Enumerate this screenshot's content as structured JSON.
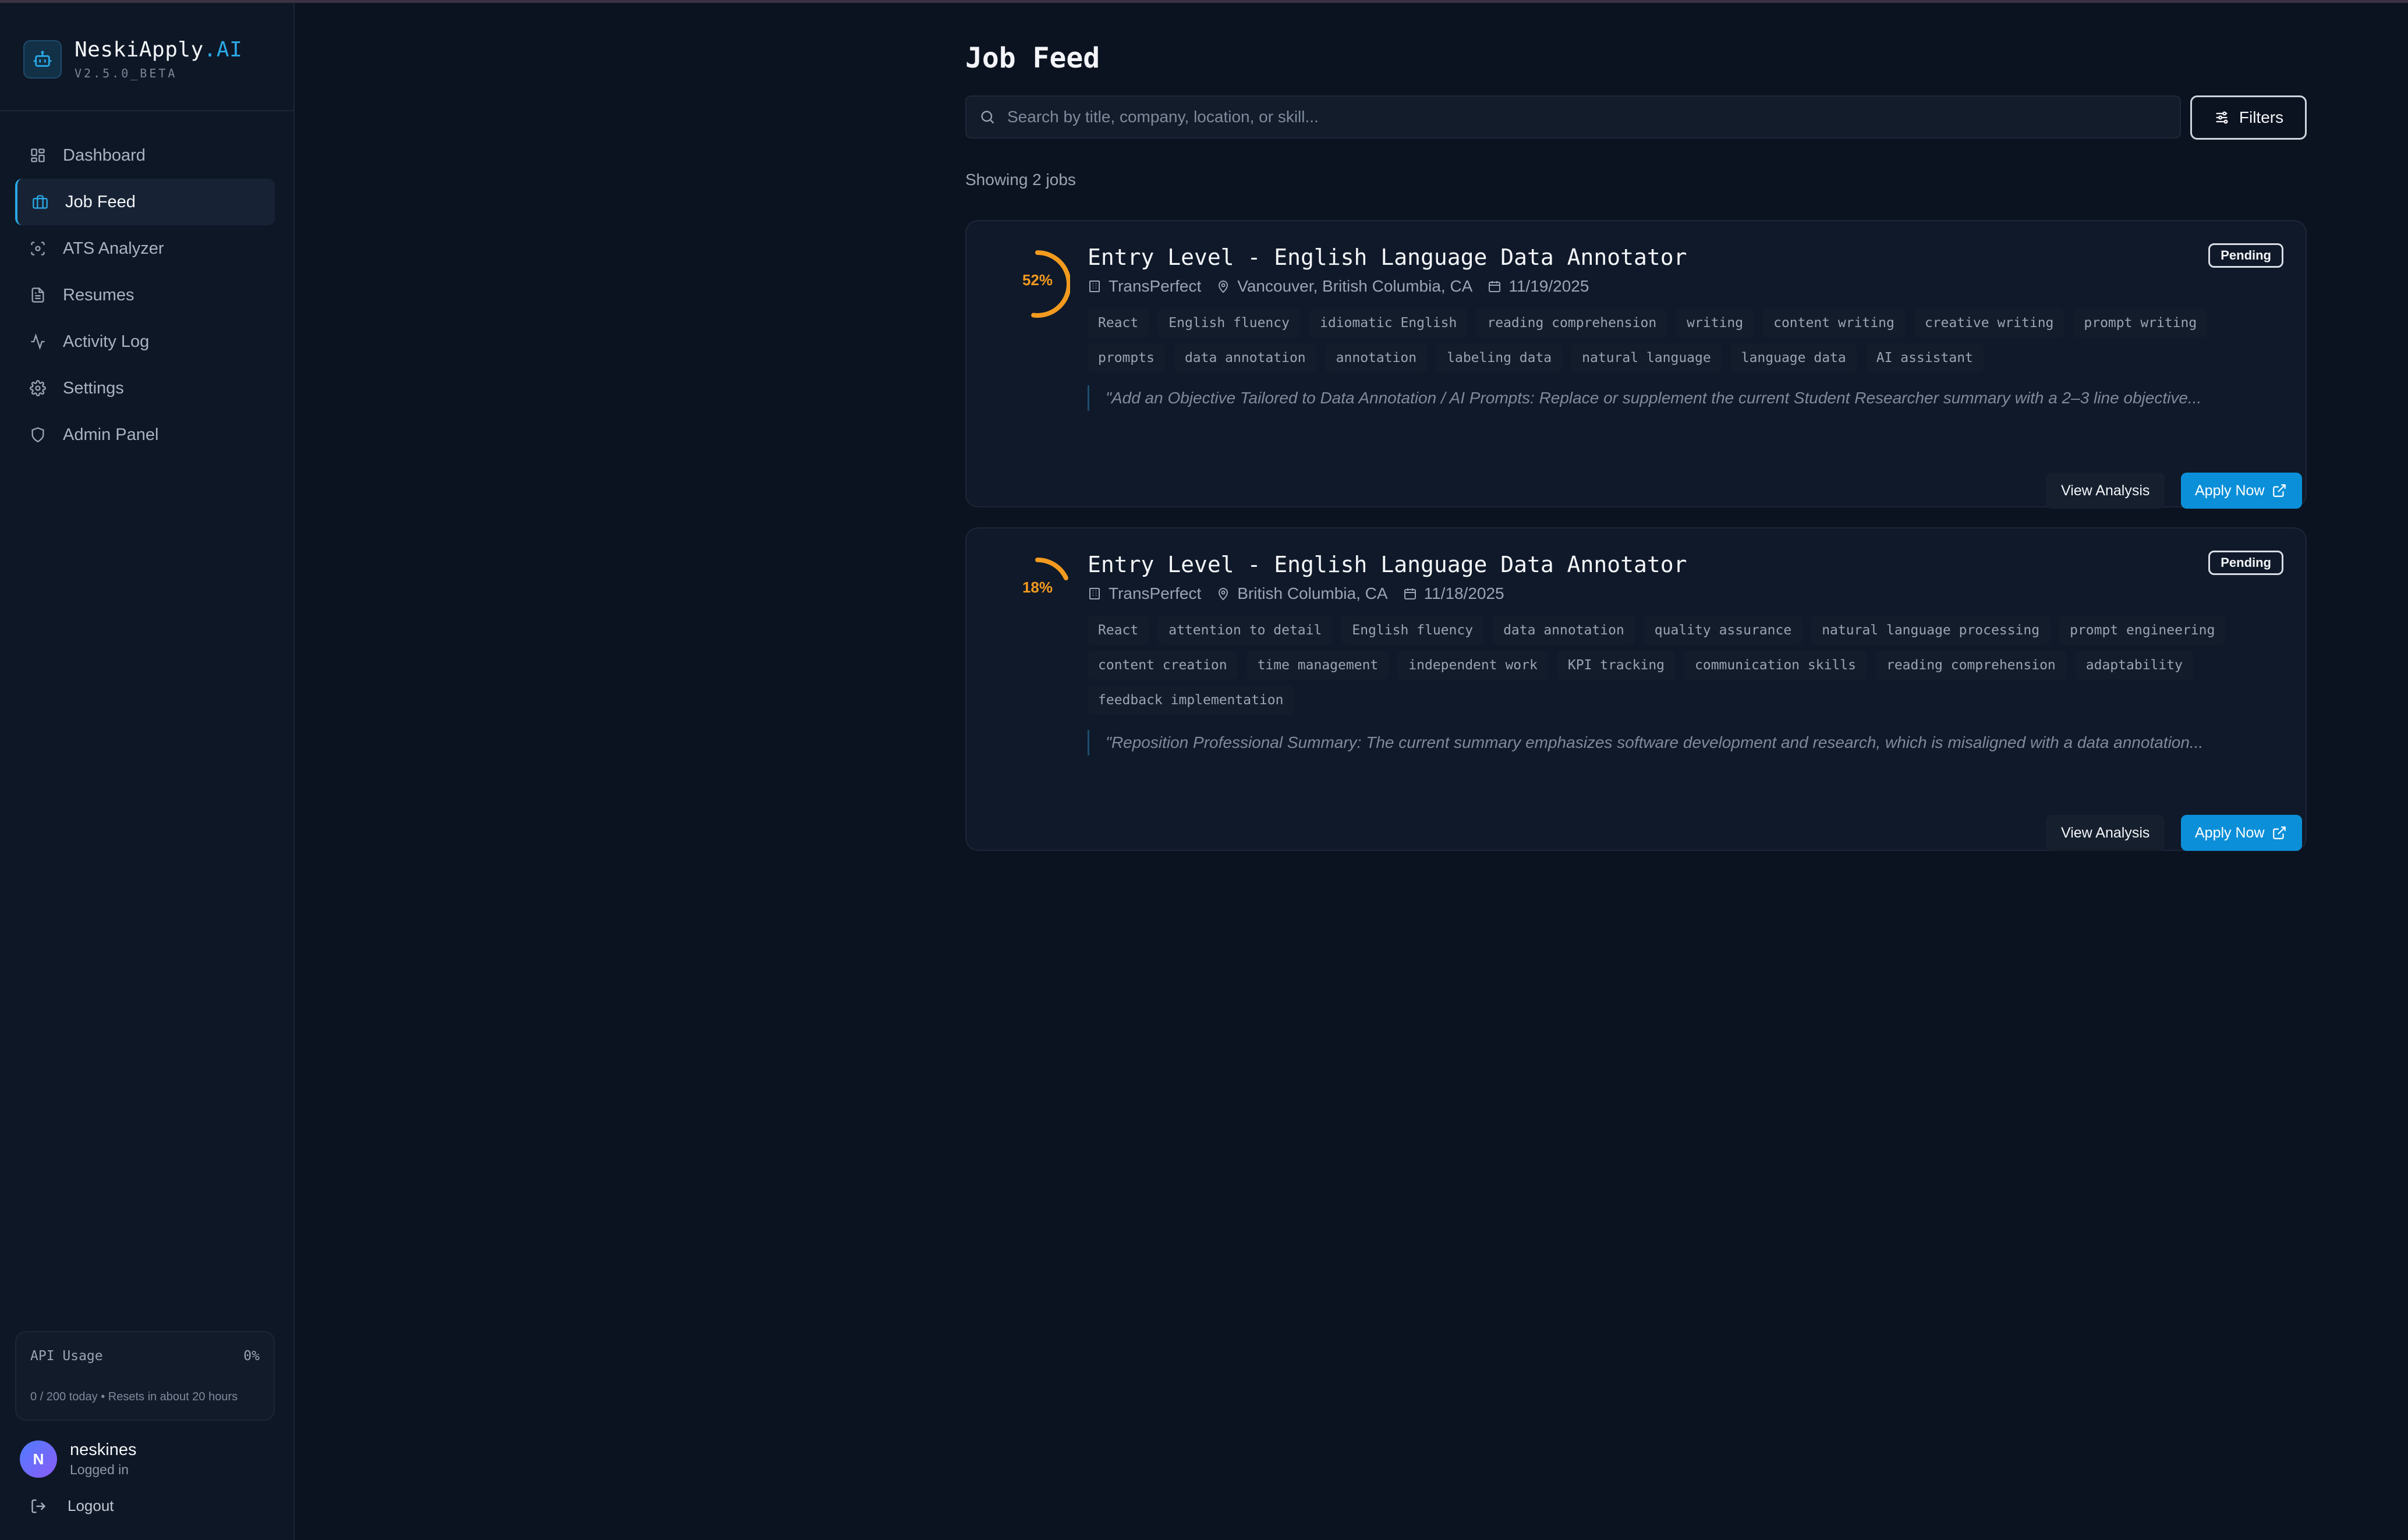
{
  "app": {
    "name": "NeskiApply",
    "name_suffix": ".AI",
    "version": "V2.5.0_BETA",
    "accent": "#2aa8e6"
  },
  "sidebar": {
    "items": [
      {
        "label": "Dashboard",
        "icon": "grid-icon"
      },
      {
        "label": "Job Feed",
        "icon": "briefcase-icon",
        "active": true
      },
      {
        "label": "ATS Analyzer",
        "icon": "scan-icon"
      },
      {
        "label": "Resumes",
        "icon": "document-icon"
      },
      {
        "label": "Activity Log",
        "icon": "activity-icon"
      },
      {
        "label": "Settings",
        "icon": "gear-icon"
      },
      {
        "label": "Admin Panel",
        "icon": "shield-icon"
      }
    ],
    "api_usage": {
      "title": "API Usage",
      "percent": "0%",
      "detail": "0 / 200 today • Resets in about 20 hours"
    },
    "user": {
      "initial": "N",
      "name": "neskines",
      "status": "Logged in"
    },
    "logout_label": "Logout"
  },
  "main": {
    "title": "Job Feed",
    "search_placeholder": "Search by title, company, location, or skill...",
    "search_value": "",
    "filters_label": "Filters",
    "showing_text": "Showing 2 jobs",
    "jobs": [
      {
        "match_text": "52%",
        "match_fraction": 0.52,
        "title": "Entry Level - English Language Data Annotator",
        "company": "TransPerfect",
        "location": "Vancouver, British Columbia, CA",
        "date": "11/19/2025",
        "status": "Pending",
        "tags": [
          "React",
          "English fluency",
          "idiomatic English",
          "reading comprehension",
          "writing",
          "content writing",
          "creative writing",
          "prompt writing",
          "prompts",
          "data annotation",
          "annotation",
          "labeling data",
          "natural language",
          "language data",
          "AI assistant"
        ],
        "suggestion": "\"Add an Objective Tailored to Data Annotation / AI Prompts: Replace or supplement the current Student Researcher summary with a 2–3 line objective...",
        "view_label": "View Analysis",
        "apply_label": "Apply Now"
      },
      {
        "match_text": "18%",
        "match_fraction": 0.18,
        "title": "Entry Level - English Language Data Annotator",
        "company": "TransPerfect",
        "location": "British Columbia, CA",
        "date": "11/18/2025",
        "status": "Pending",
        "tags": [
          "React",
          "attention to detail",
          "English fluency",
          "data annotation",
          "quality assurance",
          "natural language processing",
          "prompt engineering",
          "content creation",
          "time management",
          "independent work",
          "KPI tracking",
          "communication skills",
          "reading comprehension",
          "adaptability",
          "feedback implementation"
        ],
        "suggestion": "\"Reposition Professional Summary: The current summary emphasizes software development and research, which is misaligned with a data annotation...",
        "view_label": "View Analysis",
        "apply_label": "Apply Now"
      }
    ]
  },
  "colors": {
    "background": "#0c1320",
    "match_ring": "#f39a1f",
    "apply_button": "#0b8fd8"
  }
}
